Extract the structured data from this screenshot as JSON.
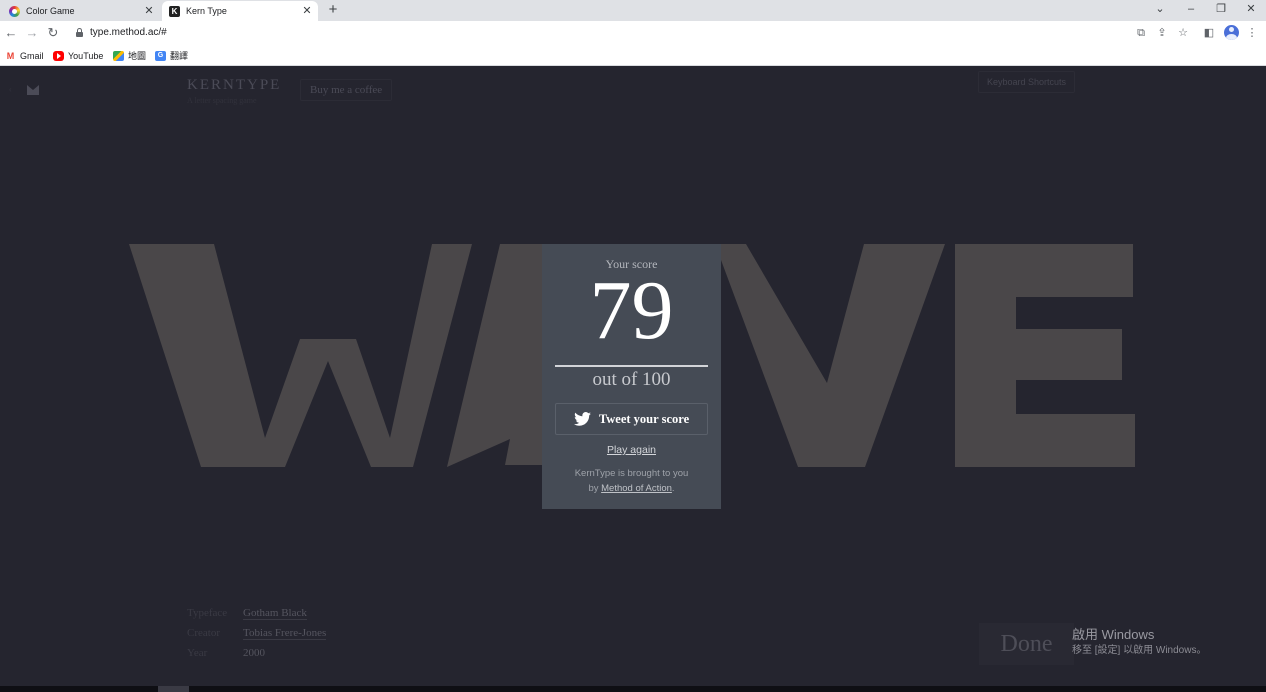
{
  "browser": {
    "tabs": [
      {
        "title": "Color Game",
        "icon": "color-wheel-icon",
        "active": false
      },
      {
        "title": "Kern Type",
        "icon": "k-favicon",
        "active": true
      }
    ],
    "url": "type.method.ac/#",
    "bookmarks": [
      {
        "label": "Gmail",
        "icon": "gmail-icon"
      },
      {
        "label": "YouTube",
        "icon": "youtube-icon"
      },
      {
        "label": "地圖",
        "icon": "maps-icon"
      },
      {
        "label": "翻譯",
        "icon": "translate-icon"
      }
    ]
  },
  "header": {
    "brand": "KERNTYPE",
    "tagline": "A letter spacing game",
    "coffee_label": "Buy me a coffee",
    "shortcuts_label": "Keyboard Shortcuts"
  },
  "game": {
    "word": "WAVE",
    "letter_color": "#4a4749"
  },
  "result": {
    "label": "Your score",
    "score": "79",
    "out_of": "out of 100",
    "tweet_label": "Tweet your score",
    "play_again_label": "Play again",
    "credit_line1": "KernType is brought to you",
    "credit_prefix": "by ",
    "credit_link": "Method of Action",
    "credit_suffix": "."
  },
  "font_info": {
    "typeface_label": "Typeface",
    "typeface": "Gotham Black",
    "creator_label": "Creator",
    "creator": "Tobias Frere-Jones",
    "year_label": "Year",
    "year": "2000"
  },
  "done_label": "Done",
  "watermark": {
    "line1": "啟用 Windows",
    "line2": "移至 [設定] 以啟用 Windows。"
  },
  "colors": {
    "page_bg": "#25252f",
    "modal_bg": "#454b55",
    "letters": "#4a4749"
  }
}
